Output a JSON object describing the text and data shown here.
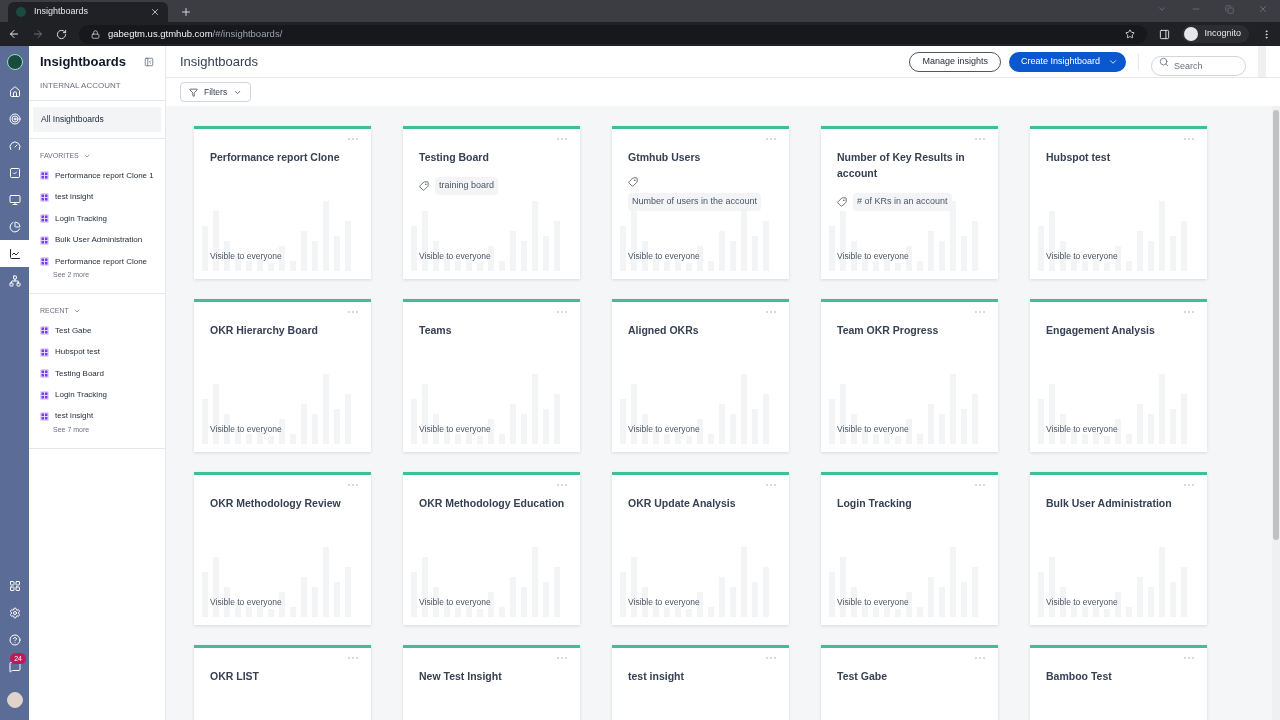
{
  "browser": {
    "tab_title": "Insightboards",
    "url_host": "gabegtm.us.gtmhub.com",
    "url_path": "/#/insightboards/",
    "profile": "Incognito"
  },
  "rail": {
    "items": [
      {
        "kind": "home",
        "selected": false
      },
      {
        "kind": "target",
        "selected": false
      },
      {
        "kind": "gauge",
        "selected": false
      },
      {
        "kind": "tasks",
        "selected": false
      },
      {
        "kind": "screen",
        "selected": false
      },
      {
        "kind": "pie",
        "selected": false
      },
      {
        "kind": "insights",
        "selected": true
      },
      {
        "kind": "people",
        "selected": false
      }
    ],
    "bottom": [
      {
        "kind": "apps"
      },
      {
        "kind": "settings"
      },
      {
        "kind": "help"
      },
      {
        "kind": "notifications",
        "badge": "24"
      }
    ]
  },
  "sidebar": {
    "title": "Insightboards",
    "account": "INTERNAL ACCOUNT",
    "all": {
      "label": "All Insightboards",
      "selected": true
    },
    "sections": [
      {
        "title": "FAVORITES",
        "items": [
          "Performance report Clone 1",
          "test insight",
          "Login Tracking",
          "Bulk User Administration",
          "Performance report Clone"
        ],
        "more": "See 2 more"
      },
      {
        "title": "RECENT",
        "items": [
          "Test Gabe",
          "Hubspot test",
          "Testing Board",
          "Login Tracking",
          "test insight"
        ],
        "more": "See 7 more"
      }
    ]
  },
  "header": {
    "title": "Insightboards",
    "manage": "Manage insights",
    "create": "Create Insightboard",
    "search_placeholder": "Search",
    "filters": "Filters"
  },
  "cards": [
    {
      "title": "Performance report Clone",
      "visibility": "Visible to everyone"
    },
    {
      "title": "Testing Board",
      "tag": "training board",
      "visibility": "Visible to everyone"
    },
    {
      "title": "Gtmhub Users",
      "tag": "Number of users in the account",
      "visibility": "Visible to everyone"
    },
    {
      "title": "Number of Key Results in account",
      "tag": "# of KRs in an account",
      "visibility": "Visible to everyone"
    },
    {
      "title": "Hubspot test",
      "visibility": "Visible to everyone"
    },
    {
      "title": "OKR Hierarchy Board",
      "visibility": "Visible to everyone"
    },
    {
      "title": "Teams",
      "visibility": "Visible to everyone"
    },
    {
      "title": "Aligned OKRs",
      "visibility": "Visible to everyone"
    },
    {
      "title": "Team OKR Progress",
      "visibility": "Visible to everyone"
    },
    {
      "title": "Engagement Analysis",
      "visibility": "Visible to everyone"
    },
    {
      "title": "OKR Methodology Review",
      "visibility": "Visible to everyone"
    },
    {
      "title": "OKR Methodology Education",
      "visibility": "Visible to everyone"
    },
    {
      "title": "OKR Update Analysis",
      "visibility": "Visible to everyone"
    },
    {
      "title": "Login Tracking",
      "visibility": "Visible to everyone"
    },
    {
      "title": "Bulk User Administration",
      "visibility": "Visible to everyone"
    },
    {
      "title": "OKR LIST"
    },
    {
      "title": "New Test Insight"
    },
    {
      "title": "test insight"
    },
    {
      "title": "Test Gabe"
    },
    {
      "title": "Bamboo Test"
    }
  ]
}
